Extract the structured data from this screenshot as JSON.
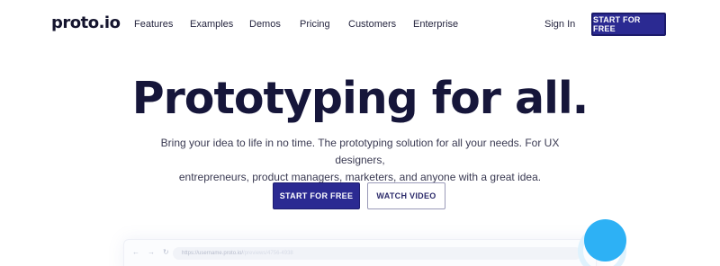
{
  "nav": {
    "logo": "proto.io",
    "links": [
      "Features",
      "Examples",
      "Demos",
      "Pricing",
      "Customers",
      "Enterprise"
    ],
    "signin": "Sign In",
    "cta": "START FOR FREE"
  },
  "hero": {
    "title": "Prototyping for all.",
    "subtitle_line1": "Bring your idea to life in no time. The prototyping solution for all your needs. For UX designers,",
    "subtitle_line2": "entrepreneurs, product managers, marketers, and anyone with a great idea.",
    "primary_button": "START FOR FREE",
    "secondary_button": "WATCH VIDEO"
  },
  "browser": {
    "back": "←",
    "forward": "→",
    "reload": "↻",
    "url": "https://username.proto.io/",
    "url_faded": "/previews/4756-4938"
  },
  "colors": {
    "brand": "#2b2a92",
    "text": "#16163a",
    "accent_blue": "#2db1f5"
  }
}
